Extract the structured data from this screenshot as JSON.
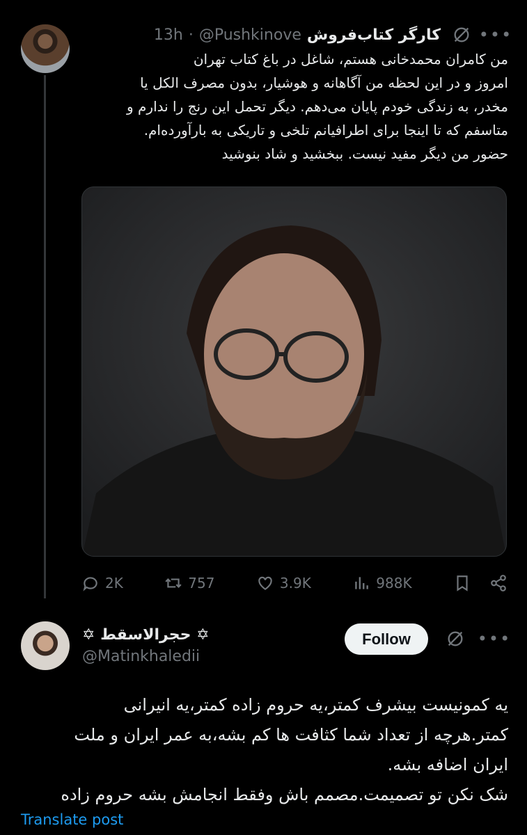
{
  "tweet": {
    "display_name": "کارگر کتاب‌فروش",
    "handle": "@Pushkinove",
    "separator": "·",
    "time": "13h",
    "text_lines": [
      "من کامران محمدخانی هستم، شاغل در باغ کتاب تهران",
      "امروز و در این لحظه من آگاهانه و هوشیار، بدون مصرف الکل یا",
      "مخدر، به زندگی خودم پایان می‌دهم. دیگر تحمل این رنج را ندارم و",
      "متاسفم که تا اینجا برای اطرافیانم تلخی و تاریکی به بارآورده‌ام.",
      "حضور من دیگر مفید نیست. ببخشید و شاد بنوشید"
    ],
    "stats": {
      "replies": "2K",
      "reposts": "757",
      "likes": "3.9K",
      "views": "988K"
    },
    "more_icon": "•••"
  },
  "reply": {
    "display_name": "✡ حجرالاسقط ✡",
    "handle": "@Matinkhaledii",
    "follow_label": "Follow",
    "more_icon": "•••",
    "text_lines": [
      "یه کمونیست بیشرف کمتر،یه حروم زاده کمتر،یه انیرانی",
      "کمتر.هرچه از تعداد شما کثافت ها کم بشه،به عمر ایران و ملت",
      "ایران اضافه بشه.",
      "شک نکن تو تصمیمت.مصمم باش وفقط انجامش بشه حروم زاده"
    ],
    "translate_label": "Translate post"
  },
  "colors": {
    "background": "#000000",
    "text": "#e7e9ea",
    "muted": "#71767b",
    "link": "#1d9bf0",
    "follow_bg": "#eff3f4"
  }
}
